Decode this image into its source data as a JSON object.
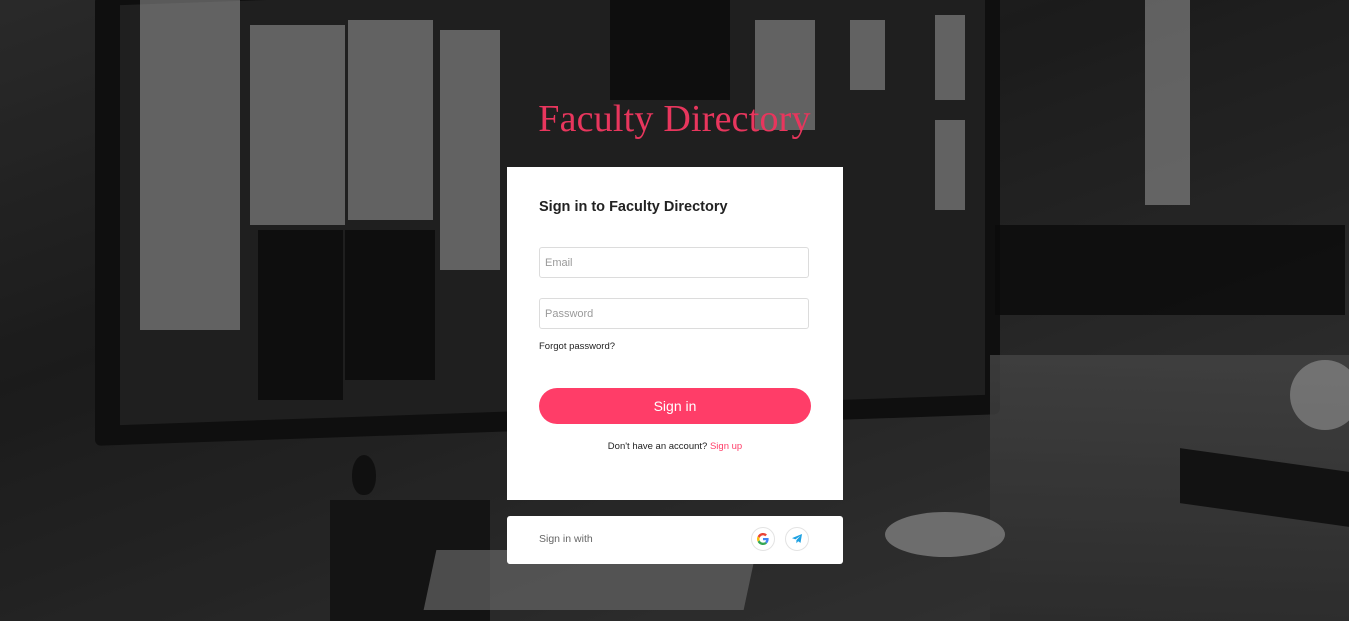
{
  "app": {
    "title": "Faculty Directory"
  },
  "login": {
    "heading": "Sign in to Faculty Directory",
    "email_placeholder": "Email",
    "password_placeholder": "Password",
    "forgot_label": "Forgot password?",
    "signin_label": "Sign in",
    "no_account_text": "Don't have an account?",
    "signup_label": "Sign up"
  },
  "social": {
    "label": "Sign in with",
    "providers": [
      {
        "name": "google",
        "icon": "google-icon"
      },
      {
        "name": "telegram",
        "icon": "telegram-icon"
      }
    ]
  },
  "colors": {
    "accent": "#ff3d68",
    "title": "#e8365d",
    "card_bg": "#ffffff"
  }
}
